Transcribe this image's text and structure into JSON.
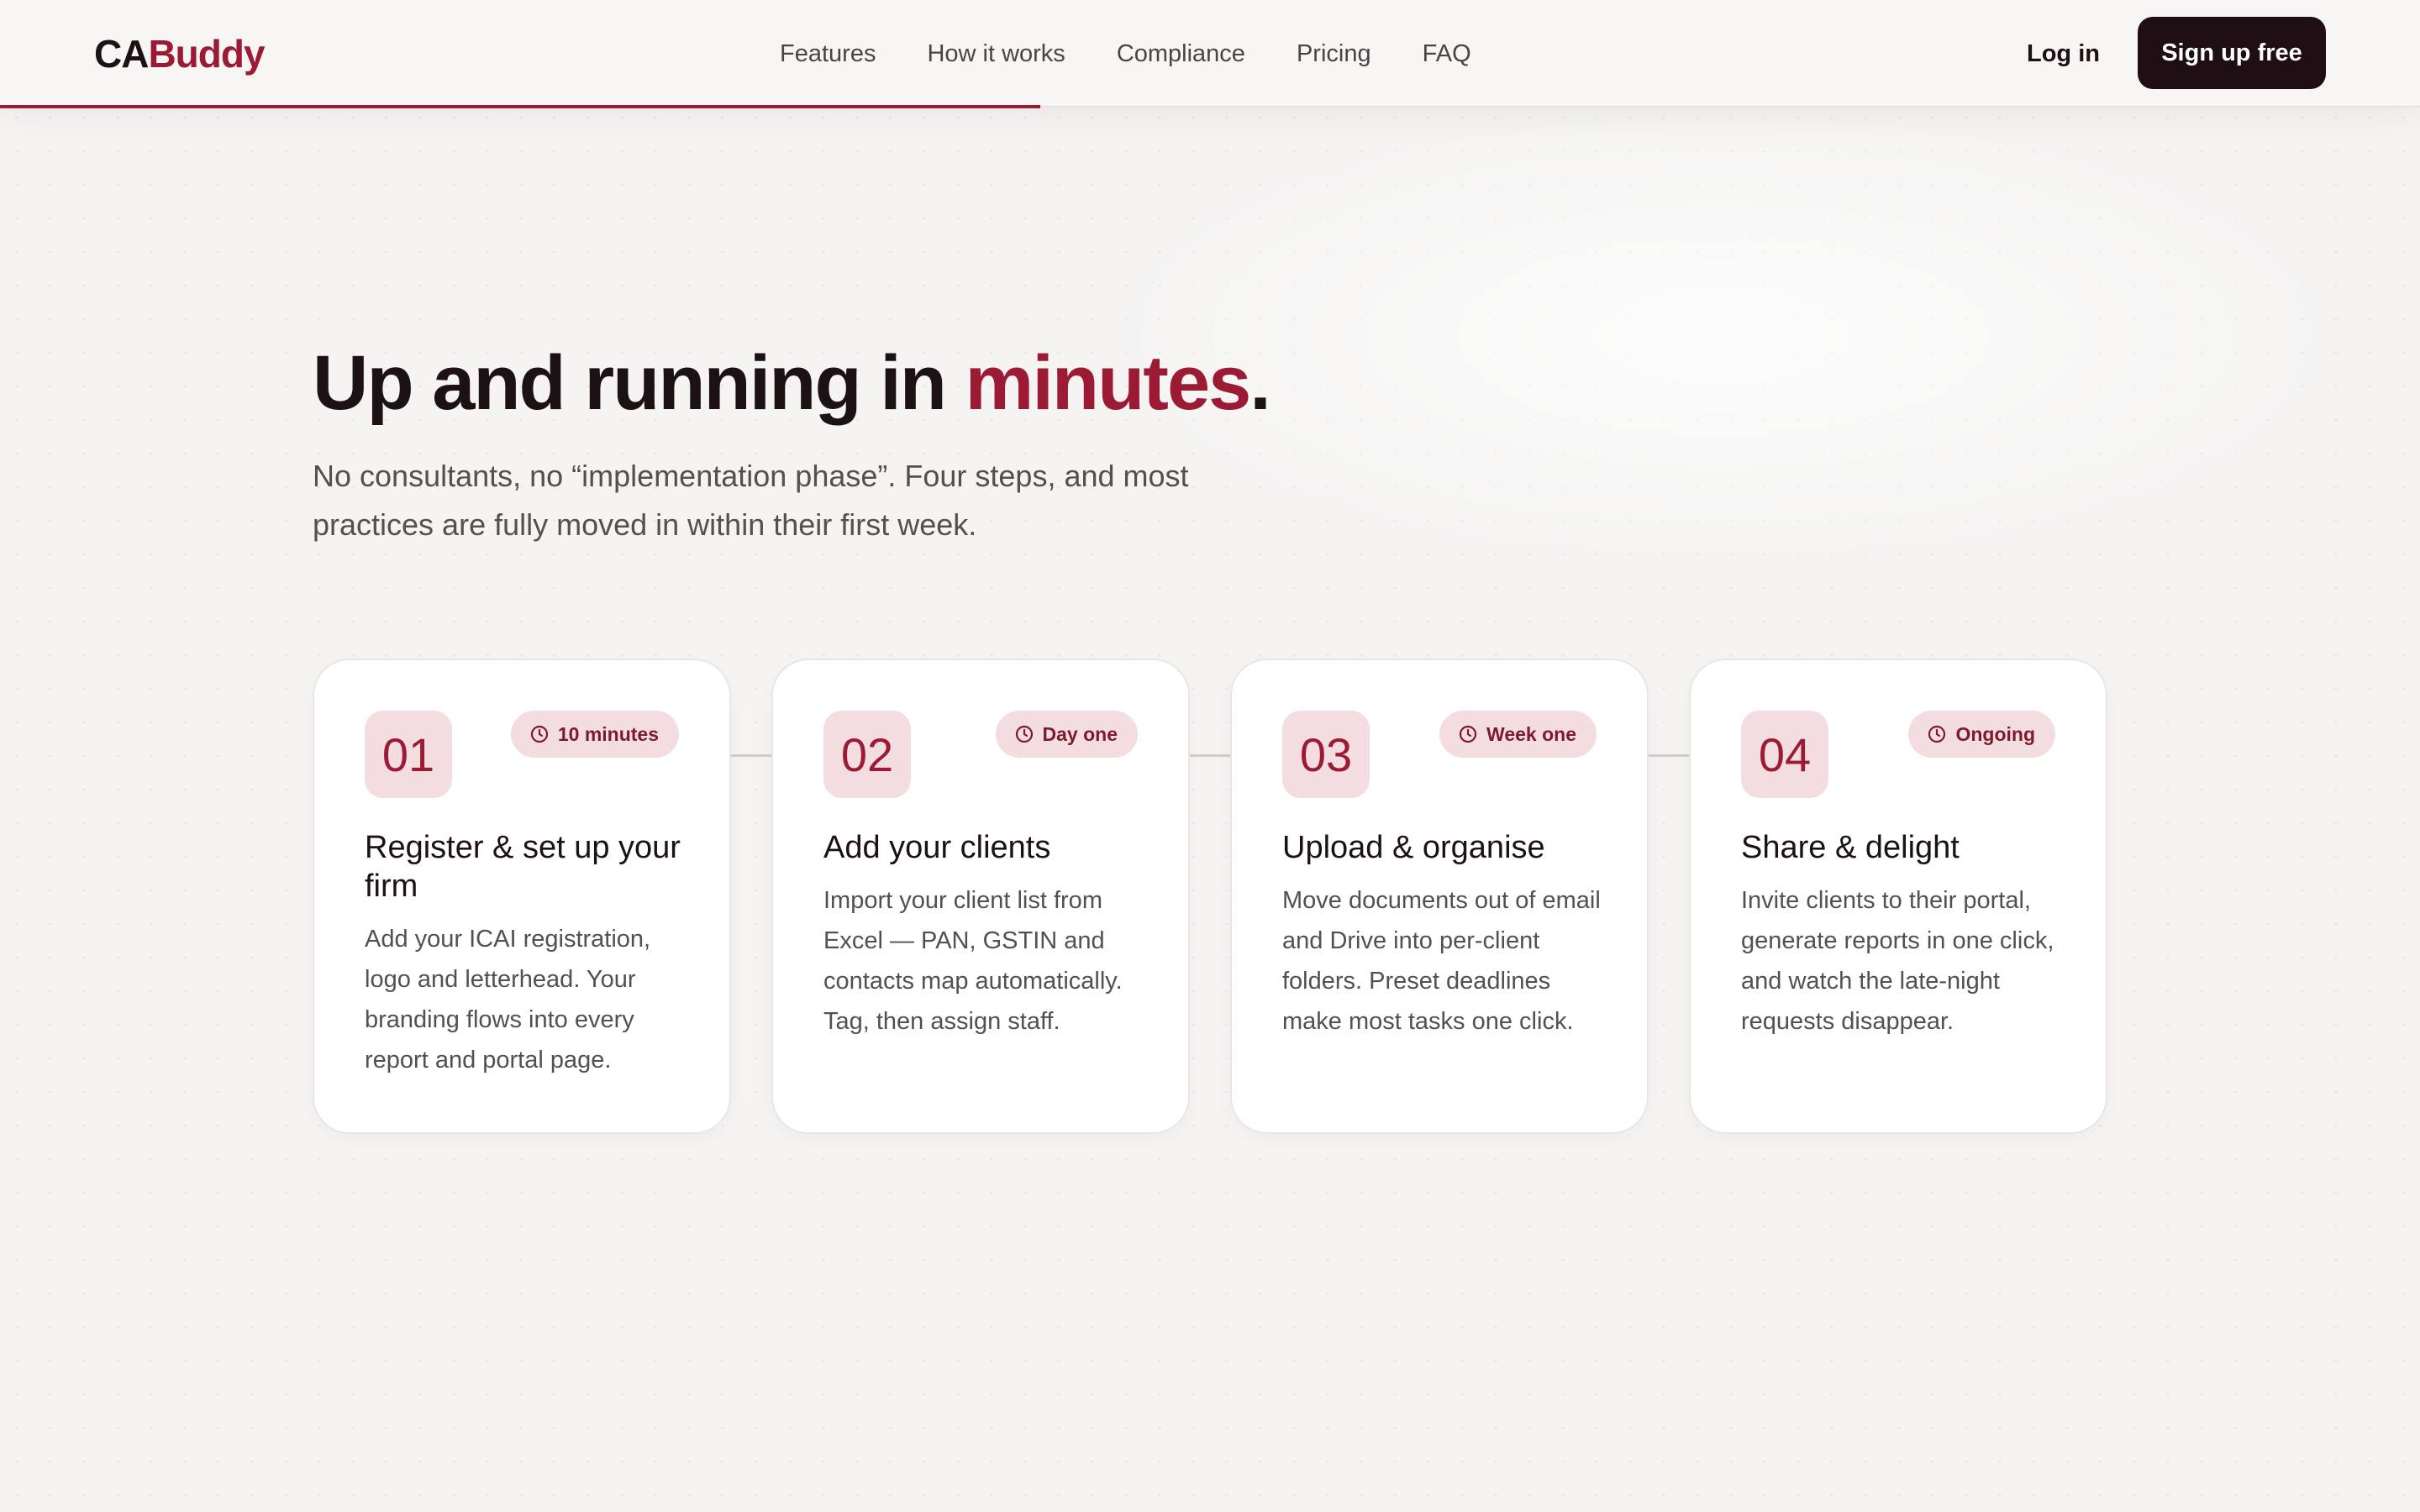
{
  "header": {
    "logo_part1": "CA",
    "logo_part2": "Buddy",
    "nav": [
      "Features",
      "How it works",
      "Compliance",
      "Pricing",
      "FAQ"
    ],
    "login_label": "Log in",
    "signup_label": "Sign up free",
    "scroll_progress_percent": 43
  },
  "hero": {
    "title_main": "Up and running in ",
    "title_accent": "minutes",
    "title_end": ".",
    "subtitle": "No consultants, no “implementation phase”. Four steps, and most practices are fully moved in within their first week."
  },
  "steps": [
    {
      "number": "01",
      "badge": "10 minutes",
      "title": "Register & set up your firm",
      "description": "Add your ICAI registration, logo and letterhead. Your branding flows into every report and portal page."
    },
    {
      "number": "02",
      "badge": "Day one",
      "title": "Add your clients",
      "description": "Import your client list from Excel — PAN, GSTIN and contacts map automatically. Tag, then assign staff."
    },
    {
      "number": "03",
      "badge": "Week one",
      "title": "Upload & organise",
      "description": "Move documents out of email and Drive into per-client folders. Preset deadlines make most tasks one click."
    },
    {
      "number": "04",
      "badge": "Ongoing",
      "title": "Share & delight",
      "description": "Invite clients to their portal, generate reports in one click, and watch the late-night requests disappear."
    }
  ],
  "icons": {
    "badge_icon": "clock-icon"
  },
  "colors": {
    "accent": "#9b1b34",
    "dark": "#1f0f14",
    "badge_bg": "#f4dde1"
  }
}
